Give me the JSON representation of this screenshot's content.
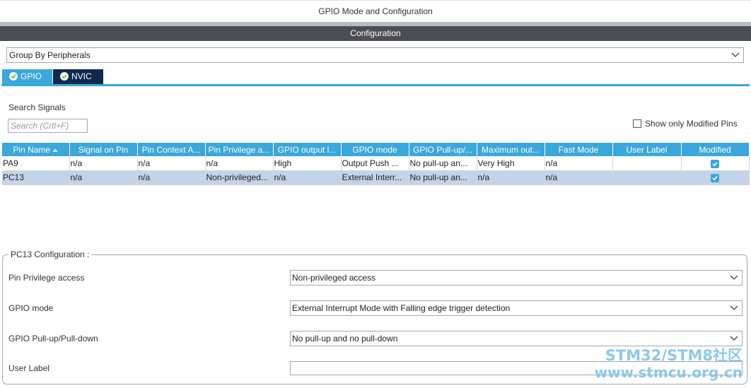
{
  "window": {
    "title": "GPIO Mode and Configuration"
  },
  "config_header": "Configuration",
  "group_select": {
    "value": "Group By Peripherals"
  },
  "tabs": [
    {
      "label": "GPIO",
      "active": true
    },
    {
      "label": "NVIC",
      "active": false
    }
  ],
  "search": {
    "label": "Search Signals",
    "placeholder": "Search (Crtl+F)"
  },
  "show_modified": {
    "label": "Show only Modified Pins",
    "checked": false
  },
  "table": {
    "headers": [
      "Pin Name",
      "Signal on Pin",
      "Pin Context A...",
      "Pin Privilege a...",
      "GPIO output l...",
      "GPIO mode",
      "GPIO Pull-up/...",
      "Maximum out...",
      "Fast Mode",
      "User Label",
      "Modified"
    ],
    "rows": [
      {
        "cells": [
          "PA9",
          "n/a",
          "n/a",
          "n/a",
          "High",
          "Output Push ...",
          "No pull-up an...",
          "Very High",
          "n/a",
          "",
          ""
        ],
        "modified": true,
        "selected": false
      },
      {
        "cells": [
          "PC13",
          "n/a",
          "n/a",
          "Non-privileged...",
          "n/a",
          "External Interr...",
          "No pull-up an...",
          "n/a",
          "n/a",
          "",
          ""
        ],
        "modified": true,
        "selected": true
      }
    ]
  },
  "pin_config": {
    "title": "PC13 Configuration :",
    "fields": [
      {
        "label": "Pin Privilege access",
        "value": "Non-privileged access",
        "type": "select"
      },
      {
        "label": "GPIO mode",
        "value": "External Interrupt Mode with Falling edge trigger detection",
        "type": "select"
      },
      {
        "label": "GPIO Pull-up/Pull-down",
        "value": "No pull-up and no pull-down",
        "type": "select"
      },
      {
        "label": "User Label",
        "value": "",
        "type": "input"
      }
    ]
  },
  "watermark": {
    "line1": "STM32/STM8社区",
    "line2": "www.stmcu.org.cn"
  },
  "colors": {
    "accent": "#3aa7dd",
    "header_dark": "#4a4d52",
    "nvic_tab": "#0e2a4e",
    "selected_row": "#c3d4e8"
  }
}
